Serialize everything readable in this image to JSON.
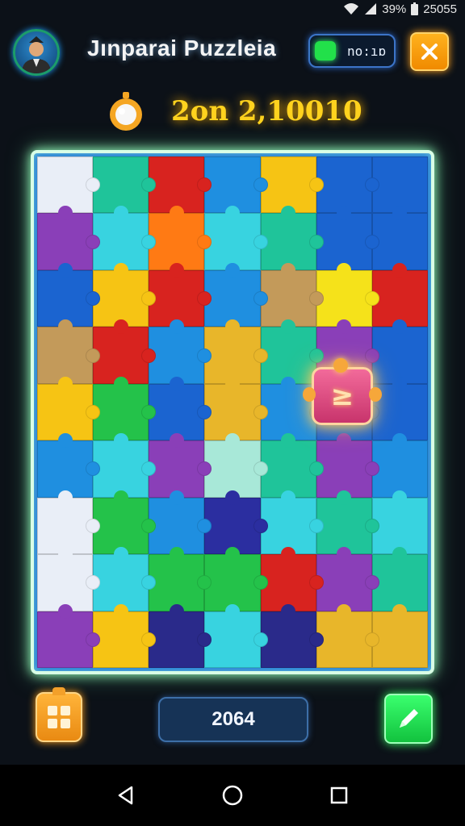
{
  "status": {
    "battery": "39%",
    "clock": "25055"
  },
  "header": {
    "title": "Jınparai  Puzzleia",
    "timer": "no:ıɒ"
  },
  "score": {
    "value": "2on 2,10010"
  },
  "floating_piece": {
    "glyph": "≥"
  },
  "footer": {
    "moves": "2064"
  },
  "colors": {
    "accent_green": "#22e04a",
    "accent_orange": "#f59a14",
    "score_yellow": "#ffd21e",
    "frame_glow": "#9affc0"
  },
  "icons": [
    "wifi-icon",
    "signal-icon",
    "battery-icon",
    "avatar",
    "close-icon",
    "stopwatch-icon",
    "grid-icon",
    "pencil-icon",
    "back-icon",
    "home-icon",
    "recents-icon"
  ],
  "board": {
    "rows": 9,
    "cols": 7,
    "palette": [
      "#e9eef7",
      "#1fc49a",
      "#d8231f",
      "#1f8fe0",
      "#f6c414",
      "#8a3fb8",
      "#38d3e0",
      "#ff7a14",
      "#24c24a",
      "#1b64d0",
      "#c39a5a",
      "#f5e21a",
      "#e8b62a",
      "#2b2ea0",
      "#a8e8d8",
      "#2a2a8a"
    ],
    "layout": [
      [
        0,
        1,
        2,
        3,
        4,
        9,
        9
      ],
      [
        5,
        6,
        7,
        6,
        1,
        9,
        9
      ],
      [
        9,
        4,
        2,
        3,
        10,
        11,
        2
      ],
      [
        10,
        2,
        3,
        12,
        1,
        5,
        9
      ],
      [
        4,
        8,
        9,
        12,
        3,
        9,
        9
      ],
      [
        3,
        6,
        5,
        14,
        1,
        5,
        3
      ],
      [
        0,
        8,
        3,
        13,
        6,
        1,
        6
      ],
      [
        0,
        6,
        8,
        8,
        2,
        5,
        1
      ],
      [
        5,
        4,
        15,
        6,
        15,
        12,
        12
      ]
    ]
  }
}
